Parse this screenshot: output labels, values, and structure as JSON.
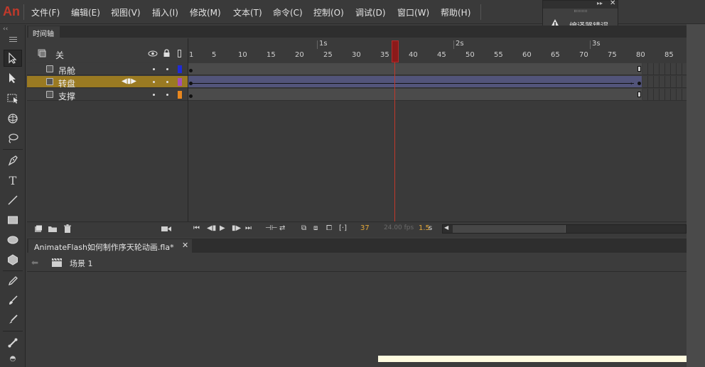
{
  "app": {
    "logo": "An"
  },
  "menu": [
    "文件(F)",
    "编辑(E)",
    "视图(V)",
    "插入(I)",
    "修改(M)",
    "文本(T)",
    "命令(C)",
    "控制(O)",
    "调试(D)",
    "窗口(W)",
    "帮助(H)"
  ],
  "error_panel": {
    "label": "编译器错误"
  },
  "timeline": {
    "tab_label": "时间轴",
    "header_layer_label": "关",
    "seconds": [
      "1s",
      "2s",
      "3s"
    ],
    "frame_numbers": [
      "1",
      "5",
      "10",
      "15",
      "20",
      "25",
      "30",
      "35",
      "40",
      "45",
      "50",
      "55",
      "60",
      "65",
      "70",
      "75",
      "80",
      "85"
    ],
    "layers": [
      {
        "name": "吊舱",
        "color": "#1f2bd6",
        "selected": false
      },
      {
        "name": "转盘",
        "color": "#a44fb6",
        "selected": true
      },
      {
        "name": "支撑",
        "color": "#e8871e",
        "selected": false
      }
    ],
    "current_frame": "37",
    "fps": "24.00 fps",
    "elapsed": "1.5",
    "elapsed_unit": "s"
  },
  "document": {
    "tab_label": "AnimateFlash如何制作序天轮动画.fla*",
    "scene_label": "场景 1"
  }
}
